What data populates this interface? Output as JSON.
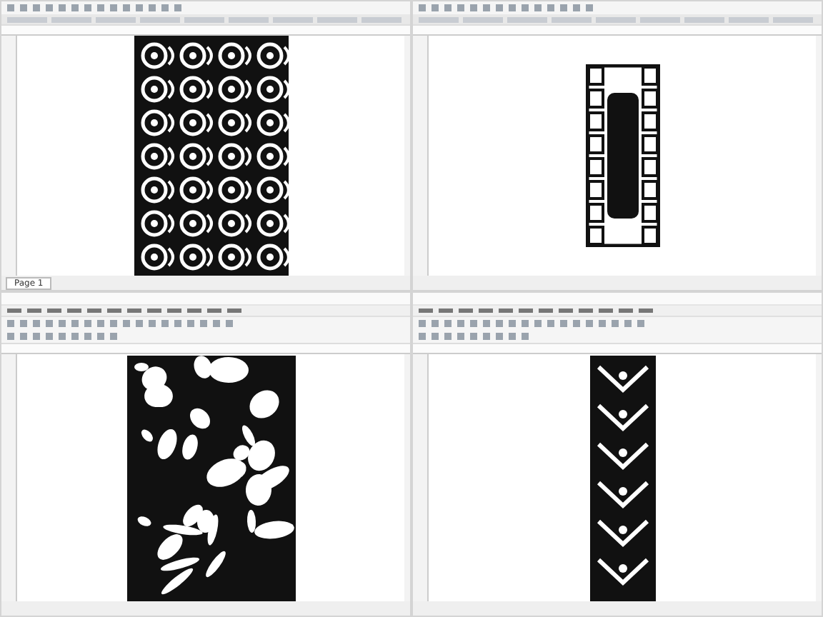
{
  "windows": [
    {
      "kind": "compact",
      "panel": {
        "kind": "arabesque"
      },
      "page_tab": {
        "label": "Page 1"
      }
    },
    {
      "kind": "compact",
      "panel": {
        "kind": "lattice"
      }
    },
    {
      "kind": "full",
      "panel": {
        "kind": "organic"
      }
    },
    {
      "kind": "full",
      "panel": {
        "kind": "strip"
      }
    }
  ]
}
